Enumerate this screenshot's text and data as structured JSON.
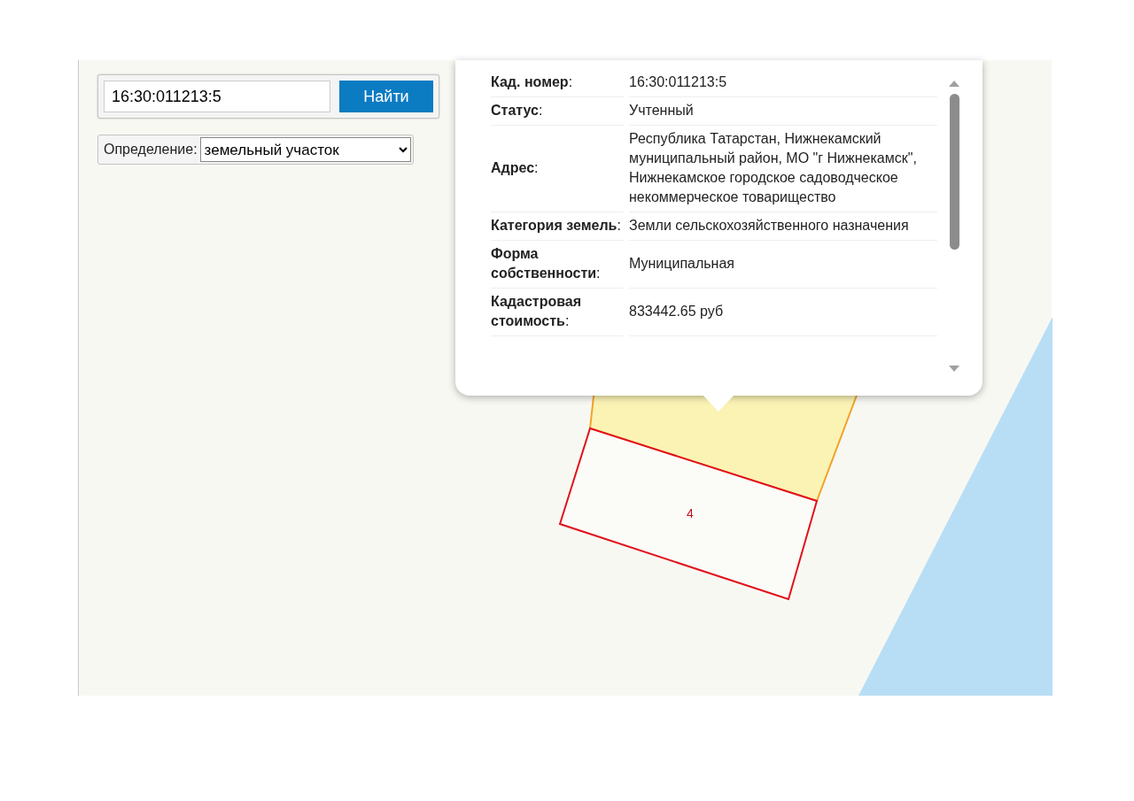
{
  "search": {
    "value": "16:30:011213:5",
    "button": "Найти"
  },
  "definition": {
    "label": "Определение:",
    "value": "земельный участок"
  },
  "popup": {
    "rows": [
      {
        "label": "**Кад. номер**:",
        "value": "16:30:011213:5"
      },
      {
        "label": "**Статус**:",
        "value": "Учтенный"
      },
      {
        "label": "**Адрес**:",
        "value": "Республика Татарстан, Нижнекамский муниципальный район, МО \"г Нижнекамск\", Нижнекамское городское садоводческое некоммерческое товарищество"
      },
      {
        "label": "**Категория земель**:",
        "value": "Земли сельскохозяйственного назначения"
      },
      {
        "label": "**Форма собственности**:",
        "value": "Муниципальная"
      },
      {
        "label": "**Кадастровая стоимость**:",
        "value": "833442.65 руб"
      }
    ]
  },
  "map": {
    "parcels": [
      {
        "selected": true
      },
      {
        "label": "4",
        "selected": false
      }
    ]
  }
}
